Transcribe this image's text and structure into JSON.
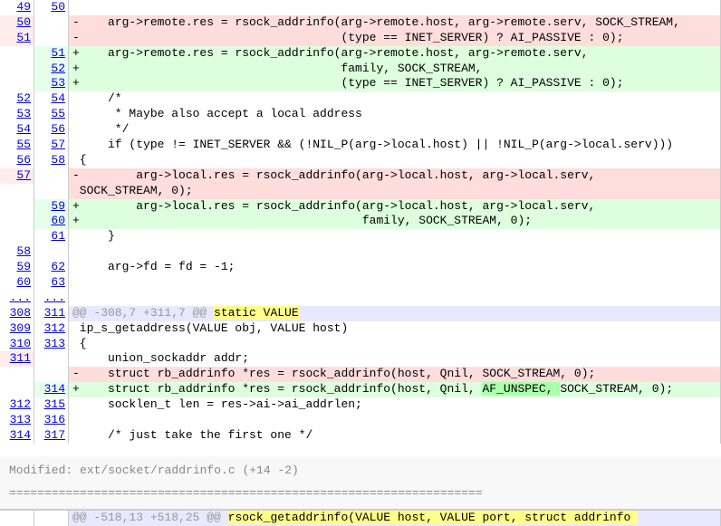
{
  "rows": [
    {
      "old": "",
      "new": "",
      "cls": "ctx",
      "content": "",
      "oldActive": false,
      "newActive": false,
      "oldLink": false,
      "newLink": false
    },
    {
      "old": "49",
      "new": "50",
      "cls": "ctx",
      "content": "",
      "oldLink": true,
      "newLink": true
    },
    {
      "old": "50",
      "new": "",
      "cls": "del",
      "content": "-    arg->remote.res = rsock_addrinfo(arg->remote.host, arg->remote.serv, SOCK_STREAM,",
      "oldLink": true,
      "oldActive": true
    },
    {
      "old": "51",
      "new": "",
      "cls": "del",
      "content": "-                                     (type == INET_SERVER) ? AI_PASSIVE : 0);",
      "oldLink": true,
      "oldActive": true
    },
    {
      "old": "",
      "new": "51",
      "cls": "add",
      "content": "+    arg->remote.res = rsock_addrinfo(arg->remote.host, arg->remote.serv,",
      "newLink": true,
      "newActive": true
    },
    {
      "old": "",
      "new": "52",
      "cls": "add",
      "content": "+                                     family, SOCK_STREAM,",
      "newLink": true,
      "newActive": true
    },
    {
      "old": "",
      "new": "53",
      "cls": "add",
      "content": "+                                     (type == INET_SERVER) ? AI_PASSIVE : 0);",
      "newLink": true,
      "newActive": true
    },
    {
      "old": "",
      "new": "",
      "cls": "ctx",
      "content": "",
      "oldLink": false,
      "newLink": false
    },
    {
      "old": "52",
      "new": "54",
      "cls": "ctx",
      "content": "     /*",
      "oldLink": true,
      "newLink": true
    },
    {
      "old": "53",
      "new": "55",
      "cls": "ctx",
      "content": "      * Maybe also accept a local address",
      "oldLink": true,
      "newLink": true
    },
    {
      "old": "54",
      "new": "56",
      "cls": "ctx",
      "content": "      */",
      "oldLink": true,
      "newLink": true
    },
    {
      "old": "",
      "new": "",
      "cls": "ctx",
      "content": "",
      "oldLink": false,
      "newLink": false
    },
    {
      "old": "55",
      "new": "57",
      "cls": "ctx",
      "content": "     if (type != INET_SERVER && (!NIL_P(arg->local.host) || !NIL_P(arg->local.serv)))",
      "oldLink": true,
      "newLink": true
    },
    {
      "old": "56",
      "new": "58",
      "cls": "ctx",
      "content": " {",
      "oldLink": true,
      "newLink": true
    },
    {
      "old": "57",
      "new": "",
      "cls": "del",
      "content": "-        arg->local.res = rsock_addrinfo(arg->local.host, arg->local.serv,",
      "oldLink": true,
      "oldActive": true
    },
    {
      "old": "",
      "new": "",
      "cls": "del",
      "content": " SOCK_STREAM, 0);",
      "oldLink": false
    },
    {
      "old": "",
      "new": "59",
      "cls": "add",
      "content": "+        arg->local.res = rsock_addrinfo(arg->local.host, arg->local.serv,",
      "newLink": true,
      "newActive": true
    },
    {
      "old": "",
      "new": "60",
      "cls": "add",
      "content": "+                                        family, SOCK_STREAM, 0);",
      "newLink": true,
      "newActive": true
    },
    {
      "old": "",
      "new": "61",
      "cls": "ctx",
      "content": "     }",
      "oldLink": false,
      "newLink": true
    },
    {
      "old": "58",
      "new": "",
      "cls": "ctx",
      "content": "",
      "oldLink": true,
      "newLink": false
    },
    {
      "old": "59",
      "new": "62",
      "cls": "ctx",
      "content": "     arg->fd = fd = -1;",
      "oldLink": true,
      "newLink": true
    },
    {
      "old": "60",
      "new": "63",
      "cls": "ctx",
      "content": "",
      "oldLink": true,
      "newLink": true
    }
  ],
  "ellipsis": {
    "old": "...",
    "new": "..."
  },
  "hunk1": {
    "meta": "@@ -308,7 +311,7 @@ ",
    "fn": "static VALUE",
    "old": "308",
    "new": "311"
  },
  "rows2": [
    {
      "old": "309",
      "new": "312",
      "cls": "ctx",
      "content": " ip_s_getaddress(VALUE obj, VALUE host)",
      "oldLink": true,
      "newLink": true
    },
    {
      "old": "310",
      "new": "313",
      "cls": "ctx",
      "content": " {",
      "oldLink": true,
      "newLink": true
    },
    {
      "old": "311",
      "new": "",
      "cls": "ctx",
      "content": "     union_sockaddr addr;",
      "oldLink": true,
      "oldActive": true
    },
    {
      "old": "",
      "new": "",
      "cls": "del",
      "content": "-    struct rb_addrinfo *res = rsock_addrinfo(host, Qnil, SOCK_STREAM, 0);",
      "oldLink": false
    },
    {
      "old": "",
      "new": "314",
      "cls": "add",
      "content": "+    struct rb_addrinfo *res = rsock_addrinfo(host, Qnil, ",
      "addedSpan": "AF_UNSPEC, ",
      "contentAfter": "SOCK_STREAM, 0);",
      "newLink": true,
      "newActive": true
    },
    {
      "old": "312",
      "new": "315",
      "cls": "ctx",
      "content": "     socklen_t len = res->ai->ai_addrlen;",
      "oldLink": true,
      "newLink": true
    },
    {
      "old": "313",
      "new": "316",
      "cls": "ctx",
      "content": "",
      "oldLink": true,
      "newLink": true
    },
    {
      "old": "314",
      "new": "317",
      "cls": "ctx",
      "content": "     /* just take the first one */",
      "oldLink": true,
      "newLink": true
    }
  ],
  "fileHeader": "  Modified: ext/socket/raddrinfo.c (+14 -2)",
  "separator": "===================================================================",
  "hunk2": {
    "meta": "@@ -518,13 +518,25 @@ ",
    "fn": "rsock_getaddrinfo(VALUE host, VALUE port, struct addrinfo "
  }
}
